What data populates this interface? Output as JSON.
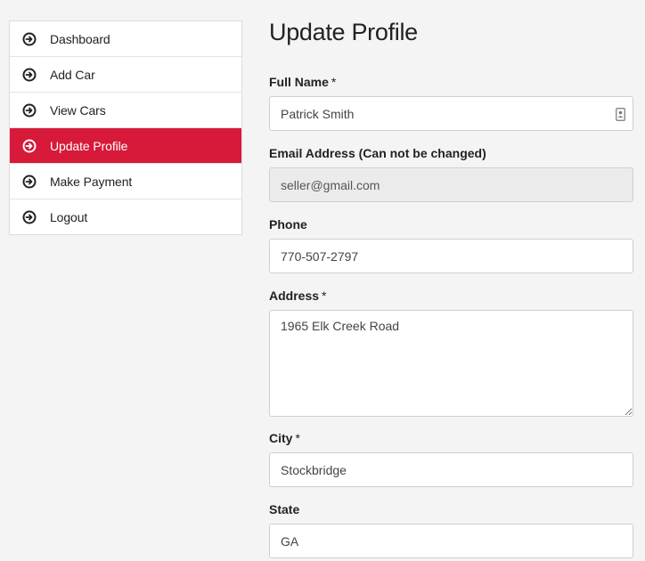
{
  "sidebar": {
    "items": [
      {
        "label": "Dashboard",
        "active": false
      },
      {
        "label": "Add Car",
        "active": false
      },
      {
        "label": "View Cars",
        "active": false
      },
      {
        "label": "Update Profile",
        "active": true
      },
      {
        "label": "Make Payment",
        "active": false
      },
      {
        "label": "Logout",
        "active": false
      }
    ],
    "icon": "circle-arrow-right-icon",
    "active_color": "#d71a3a"
  },
  "main": {
    "title": "Update Profile",
    "fields": {
      "full_name": {
        "label": "Full Name",
        "required_mark": "*",
        "value": "Patrick Smith"
      },
      "email": {
        "label": "Email Address (Can not be changed)",
        "value": "seller@gmail.com"
      },
      "phone": {
        "label": "Phone",
        "value": "770-507-2797"
      },
      "address": {
        "label": "Address",
        "required_mark": "*",
        "value": "1965 Elk Creek Road"
      },
      "city": {
        "label": "City",
        "required_mark": "*",
        "value": "Stockbridge"
      },
      "state": {
        "label": "State",
        "value": "GA"
      }
    }
  }
}
